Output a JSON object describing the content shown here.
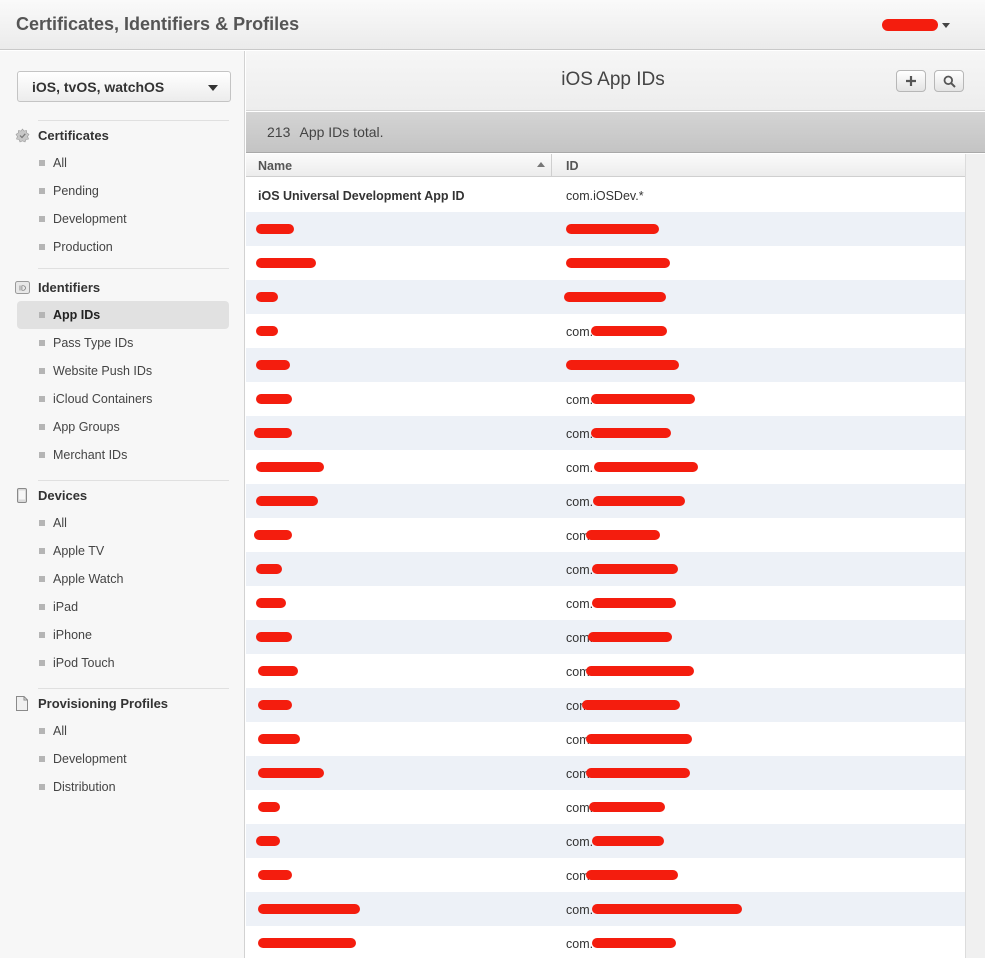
{
  "app": {
    "title": "Certificates, Identifiers & Profiles"
  },
  "colors": {
    "redaction": "#f41d0e",
    "active_nav_bg": "#e1e1e1",
    "row_alt_bg": "#edf1f7"
  },
  "sidebar": {
    "platform_select": "iOS, tvOS, watchOS",
    "sections": [
      {
        "label": "Certificates",
        "icon": "certificate-icon",
        "items": [
          "All",
          "Pending",
          "Development",
          "Production"
        ]
      },
      {
        "label": "Identifiers",
        "icon": "id-badge-icon",
        "items": [
          "App IDs",
          "Pass Type IDs",
          "Website Push IDs",
          "iCloud Containers",
          "App Groups",
          "Merchant IDs"
        ],
        "active": "App IDs"
      },
      {
        "label": "Devices",
        "icon": "device-icon",
        "items": [
          "All",
          "Apple TV",
          "Apple Watch",
          "iPad",
          "iPhone",
          "iPod Touch"
        ]
      },
      {
        "label": "Provisioning Profiles",
        "icon": "document-icon",
        "items": [
          "All",
          "Development",
          "Distribution"
        ]
      }
    ]
  },
  "main": {
    "title": "iOS App IDs",
    "add_icon": "plus-icon",
    "search_icon": "search-icon",
    "summary_count": "213",
    "summary_label": "App IDs total.",
    "columns": [
      "Name",
      "ID"
    ],
    "rows": [
      {
        "name": "iOS Universal Development App ID",
        "id": "com.iOSDev.*"
      },
      {
        "name": "",
        "id": ""
      },
      {
        "name": "",
        "id": ""
      },
      {
        "name": "",
        "id": ""
      },
      {
        "name": "",
        "id": "com."
      },
      {
        "name": "",
        "id": ""
      },
      {
        "name": "",
        "id": "com."
      },
      {
        "name": "",
        "id": "com."
      },
      {
        "name": "",
        "id": "com."
      },
      {
        "name": "",
        "id": "com."
      },
      {
        "name": "",
        "id": "com."
      },
      {
        "name": "",
        "id": "com."
      },
      {
        "name": "",
        "id": "com."
      },
      {
        "name": "",
        "id": "com."
      },
      {
        "name": "",
        "id": "com."
      },
      {
        "name": "",
        "id": "com."
      },
      {
        "name": "",
        "id": "com."
      },
      {
        "name": "",
        "id": "com."
      },
      {
        "name": "",
        "id": "com."
      },
      {
        "name": "",
        "id": "com."
      },
      {
        "name": "",
        "id": "com."
      },
      {
        "name": "",
        "id": "com."
      },
      {
        "name": "",
        "id": "com."
      }
    ]
  }
}
